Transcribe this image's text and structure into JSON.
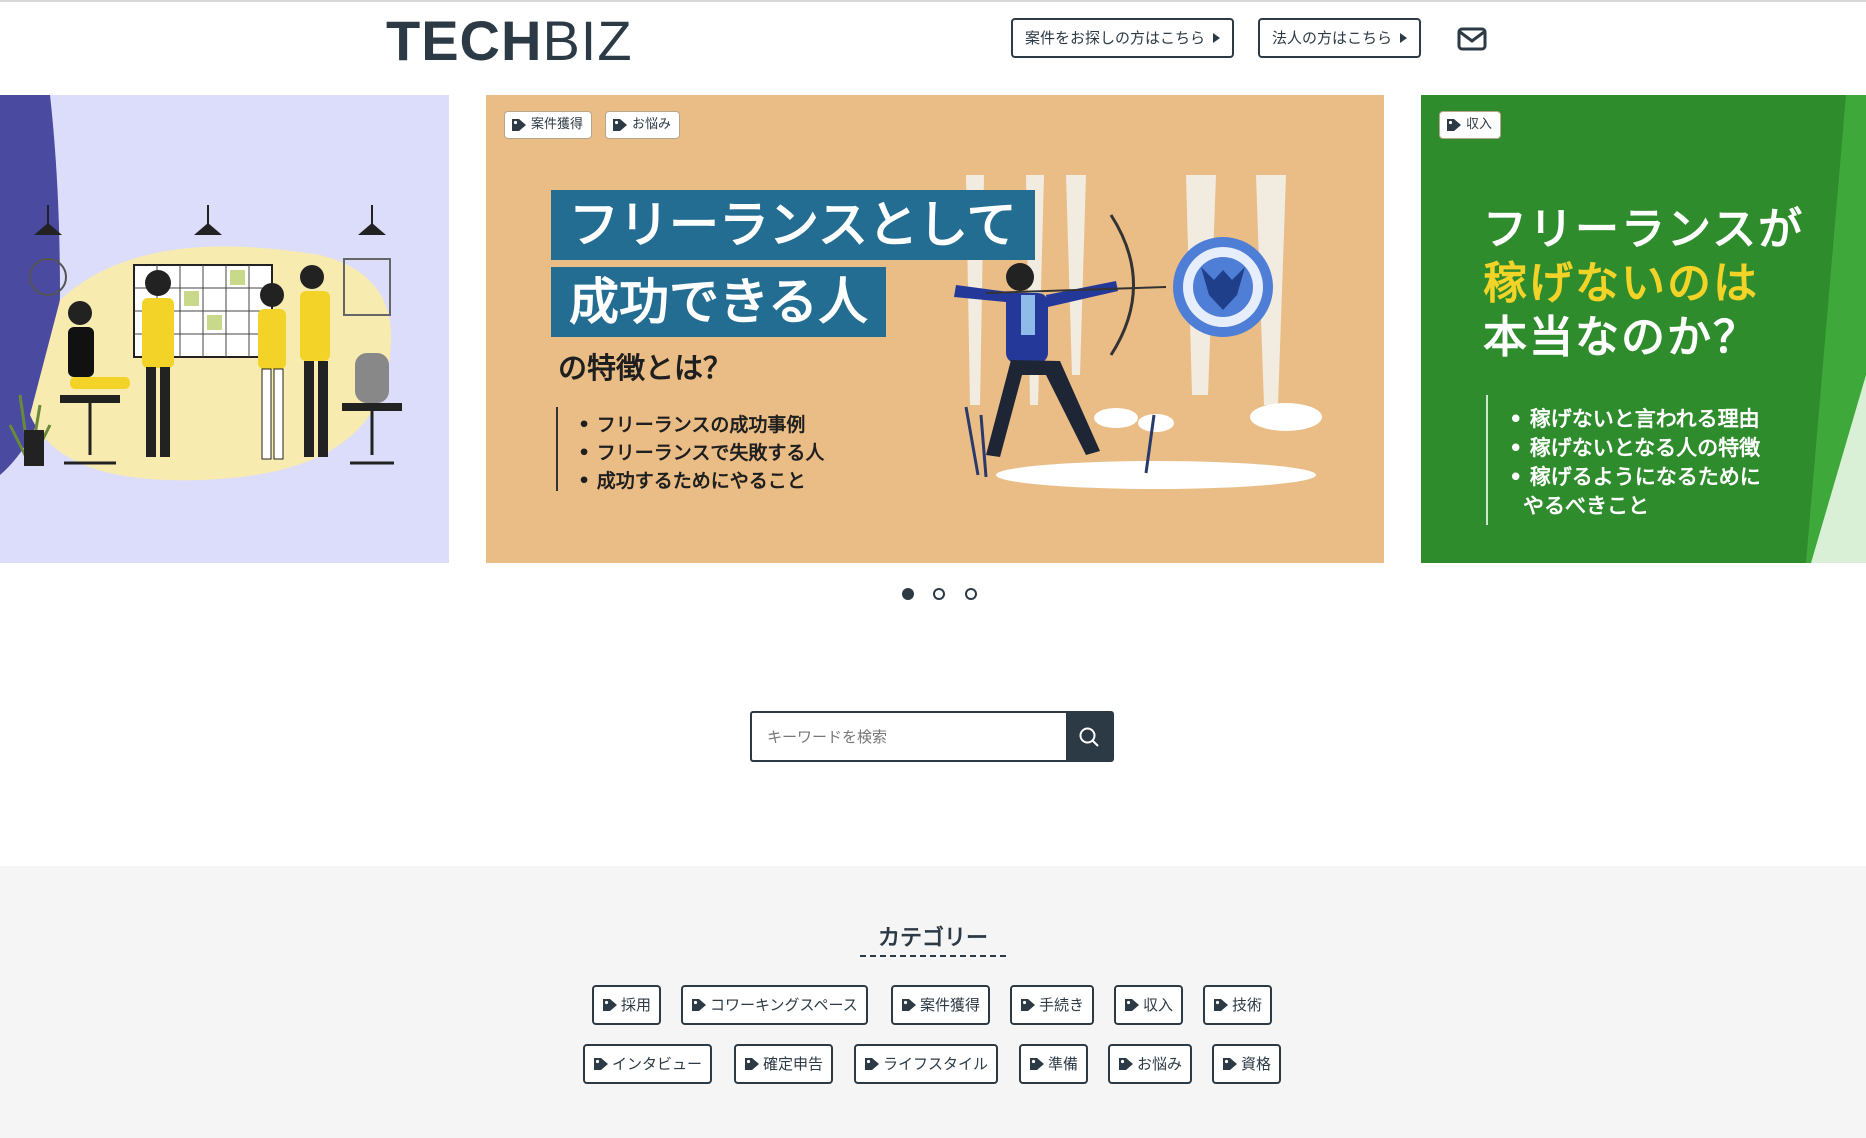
{
  "header": {
    "logo_bold": "TECH",
    "logo_light": "BIZ",
    "btn_job_seekers": "案件をお探しの方はこちら",
    "btn_corporate": "法人の方はこちら",
    "mail_icon": "envelope-icon"
  },
  "slides": [
    {
      "tags": []
    },
    {
      "tags": [
        "案件獲得",
        "お悩み"
      ],
      "headline_line1": "フリーランスとして",
      "headline_line2": "成功できる人",
      "subheadline": "の特徴とは？",
      "bullets": [
        "• フリーランスの成功事例",
        "• フリーランスで失敗する人",
        "• 成功するためにやること"
      ]
    },
    {
      "tags": [
        "収入"
      ],
      "headline_line1": "フリーランスが",
      "headline_line2": "稼げないのは",
      "headline_line3": "本当なのか？",
      "bullets": [
        "• 稼げないと言われる理由",
        "• 稼げないとなる人の特徴",
        "• 稼げるようになるために",
        "やるべきこと"
      ]
    }
  ],
  "carousel": {
    "dots": 3,
    "active_index": 0
  },
  "search": {
    "placeholder": "キーワードを検索",
    "value": ""
  },
  "categories": {
    "title": "カテゴリー",
    "row1": [
      "採用",
      "コワーキングスペース",
      "案件獲得",
      "手続き",
      "収入",
      "技術"
    ],
    "row2": [
      "インタビュー",
      "確定申告",
      "ライフスタイル",
      "準備",
      "お悩み",
      "資格"
    ]
  },
  "colors": {
    "primary": "#2c3a45",
    "slide1_bg": "#dcdcfb",
    "slide2_bg": "#eabd86",
    "slide3_bg": "#2e8c2c",
    "headline_box": "#246d92",
    "highlight_yellow": "#f3d327"
  }
}
